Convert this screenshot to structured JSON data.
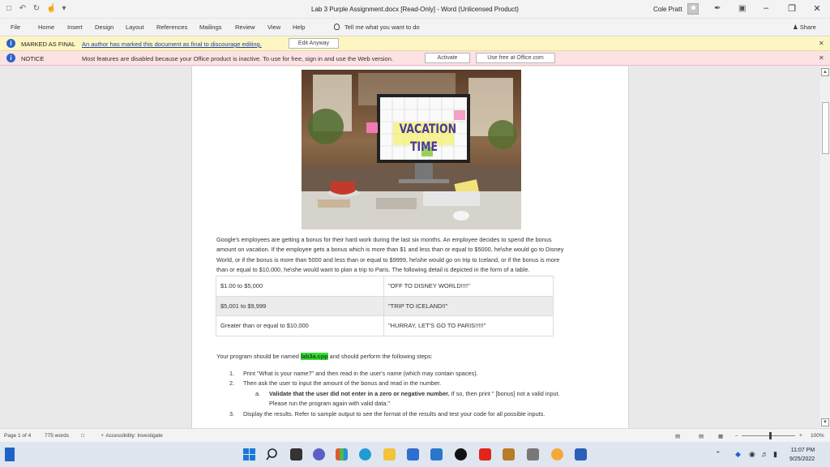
{
  "window": {
    "title": "Lab 3 Purple Assignment.docx [Read-Only] - Word (Unlicensed Product)",
    "user_name": "Cole Pratt"
  },
  "ribbon": {
    "tabs": [
      "File",
      "Home",
      "Insert",
      "Design",
      "Layout",
      "References",
      "Mailings",
      "Review",
      "View",
      "Help"
    ],
    "tell_me": "Tell me what you want to do",
    "share": "Share"
  },
  "final_bar": {
    "title": "MARKED AS FINAL",
    "message": "An author has marked this document as final to discourage editing.",
    "button": "Edit Anyway"
  },
  "notice_bar": {
    "title": "NOTICE",
    "message": "Most features are disabled because your Office product is inactive. To use for free, sign in and use the Web version.",
    "activate_button": "Activate",
    "free_button": "Use free at Office.com"
  },
  "document": {
    "image_text_1": "VACATION",
    "image_text_2": "TIME",
    "para1_line1": "Google's employees are getting a bonus for their hard work during the last six months. An employee decides to spend the bonus",
    "para1_line2": "amount on vacation. If the employee gets a bonus which is more than $1 and less than or equal to $5000, he\\she would go to Disney",
    "para1_line3": "World, or if the bonus is more than 5000 and less than or equal to $9999, he\\she would go on trip to Iceland, or if the bonus is more",
    "para1_line4": "than or equal to $10,000, he\\she would want to plan a trip to Paris. The following detail is depicted in the form of a table.",
    "table": [
      [
        "$1.00 to $5,000",
        "\"OFF TO DISNEY WORLD!!!!\""
      ],
      [
        "$5,001 to $9,999",
        "\"TRIP TO ICELAND!!\""
      ],
      [
        "Greater than or equal to $10,000",
        "\"HURRAY, LET'S GO TO PARIS!!!!!\""
      ]
    ],
    "program_pre": "Your program should be named ",
    "program_name": "lab3a.cpp",
    "program_post": " and should perform the following steps:",
    "step1_num": "1.",
    "step1": "Print \"What is your name?\" and then read in the user's name (which may contain spaces).",
    "step2_num": "2.",
    "step2": "Then ask the user to input the amount of the bonus and read in the number.",
    "step2a_num": "a.",
    "step2a_bold": "Validate that the user did not enter in a zero or negative number.",
    "step2a_rest": " If so, then print \" [bonus] not a valid input.",
    "step2a_line2": "Please run the program again with valid data.\"",
    "step3_num": "3.",
    "step3": "Display the results. Refer to sample output to see the format of the results and test your code for all possible inputs."
  },
  "status": {
    "page": "Page 1 of 4",
    "words": "775 words",
    "accessibility": "Accessibility: Investigate",
    "zoom": "100%",
    "zoom_level": 1.0
  },
  "taskbar": {
    "time": "11:07 PM",
    "date": "9/25/2022"
  }
}
